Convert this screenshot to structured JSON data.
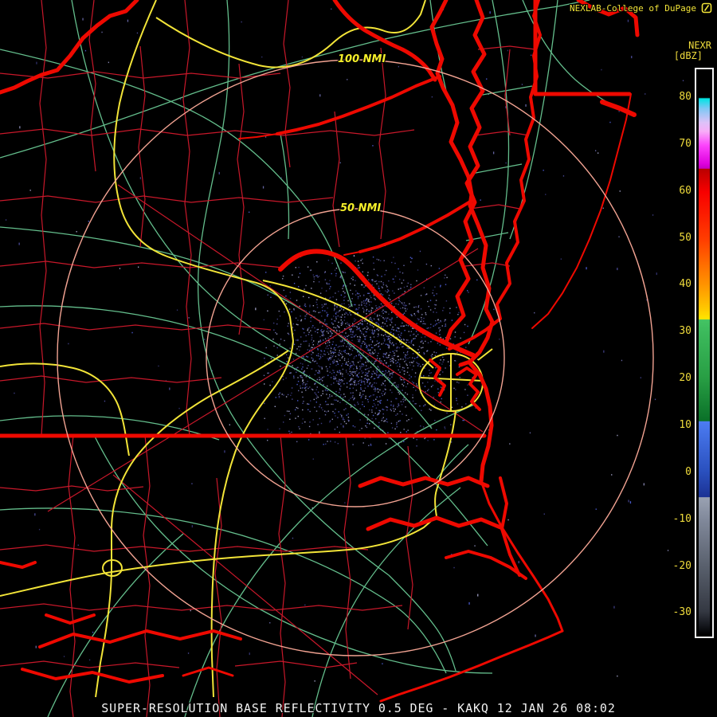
{
  "header": {
    "title": "NEXLAB-College of DuPage",
    "logo_icon": "college-of-dupage-weather-logo"
  },
  "colorbar": {
    "product_label": "NEXR",
    "units_label": "[dBZ]",
    "ticks": [
      80,
      70,
      60,
      50,
      40,
      30,
      20,
      10,
      0,
      -10,
      -20,
      -30
    ],
    "stops": [
      {
        "p": 0,
        "c": "#000000"
      },
      {
        "p": 4.6,
        "c": "#000000"
      },
      {
        "p": 4.8,
        "c": "#00e4e4"
      },
      {
        "p": 6.5,
        "c": "#7cc8f4"
      },
      {
        "p": 9.0,
        "c": "#dcc2f8"
      },
      {
        "p": 10.6,
        "c": "#f8aef8"
      },
      {
        "p": 13.1,
        "c": "#fc44fc"
      },
      {
        "p": 16.4,
        "c": "#de00de"
      },
      {
        "p": 17.2,
        "c": "#c400c4"
      },
      {
        "p": 17.3,
        "c": "#ba0000"
      },
      {
        "p": 21.4,
        "c": "#f80000"
      },
      {
        "p": 29.7,
        "c": "#ff3c00"
      },
      {
        "p": 37.9,
        "c": "#ff9400"
      },
      {
        "p": 42.1,
        "c": "#ffc800"
      },
      {
        "p": 44.0,
        "c": "#ffe600"
      },
      {
        "p": 44.1,
        "c": "#44c464"
      },
      {
        "p": 46.2,
        "c": "#3cba5c"
      },
      {
        "p": 54.5,
        "c": "#289e44"
      },
      {
        "p": 62.1,
        "c": "#0a7028"
      },
      {
        "p": 62.2,
        "c": "#4c7cf2"
      },
      {
        "p": 71.1,
        "c": "#2a50be"
      },
      {
        "p": 75.6,
        "c": "#1c3294"
      },
      {
        "p": 75.7,
        "c": "#9aa2b2"
      },
      {
        "p": 79.4,
        "c": "#828a9c"
      },
      {
        "p": 87.7,
        "c": "#5a616e"
      },
      {
        "p": 96.0,
        "c": "#343842"
      },
      {
        "p": 98.5,
        "c": "#14161c"
      },
      {
        "p": 100,
        "c": "#000000"
      }
    ]
  },
  "range_rings": [
    {
      "label": "100 NMI"
    },
    {
      "label": "50 NMI"
    }
  ],
  "status_bar": {
    "text": "SUPER-RESOLUTION BASE REFLECTIVITY 0.5 DEG - KAKQ 12 JAN 26 08:02"
  },
  "colors": {
    "coast_thick_red": "#ee0900",
    "county_thin_red": "#c8182a",
    "road_green": "#64be8c",
    "highway_yellow": "#f2e438",
    "range_ring_salmon": "#f2a392",
    "label_yellow": "#f5ef2a",
    "tick_yellow": "#f0dc3c",
    "status_white": "#f2f2f2",
    "background": "#000000"
  }
}
